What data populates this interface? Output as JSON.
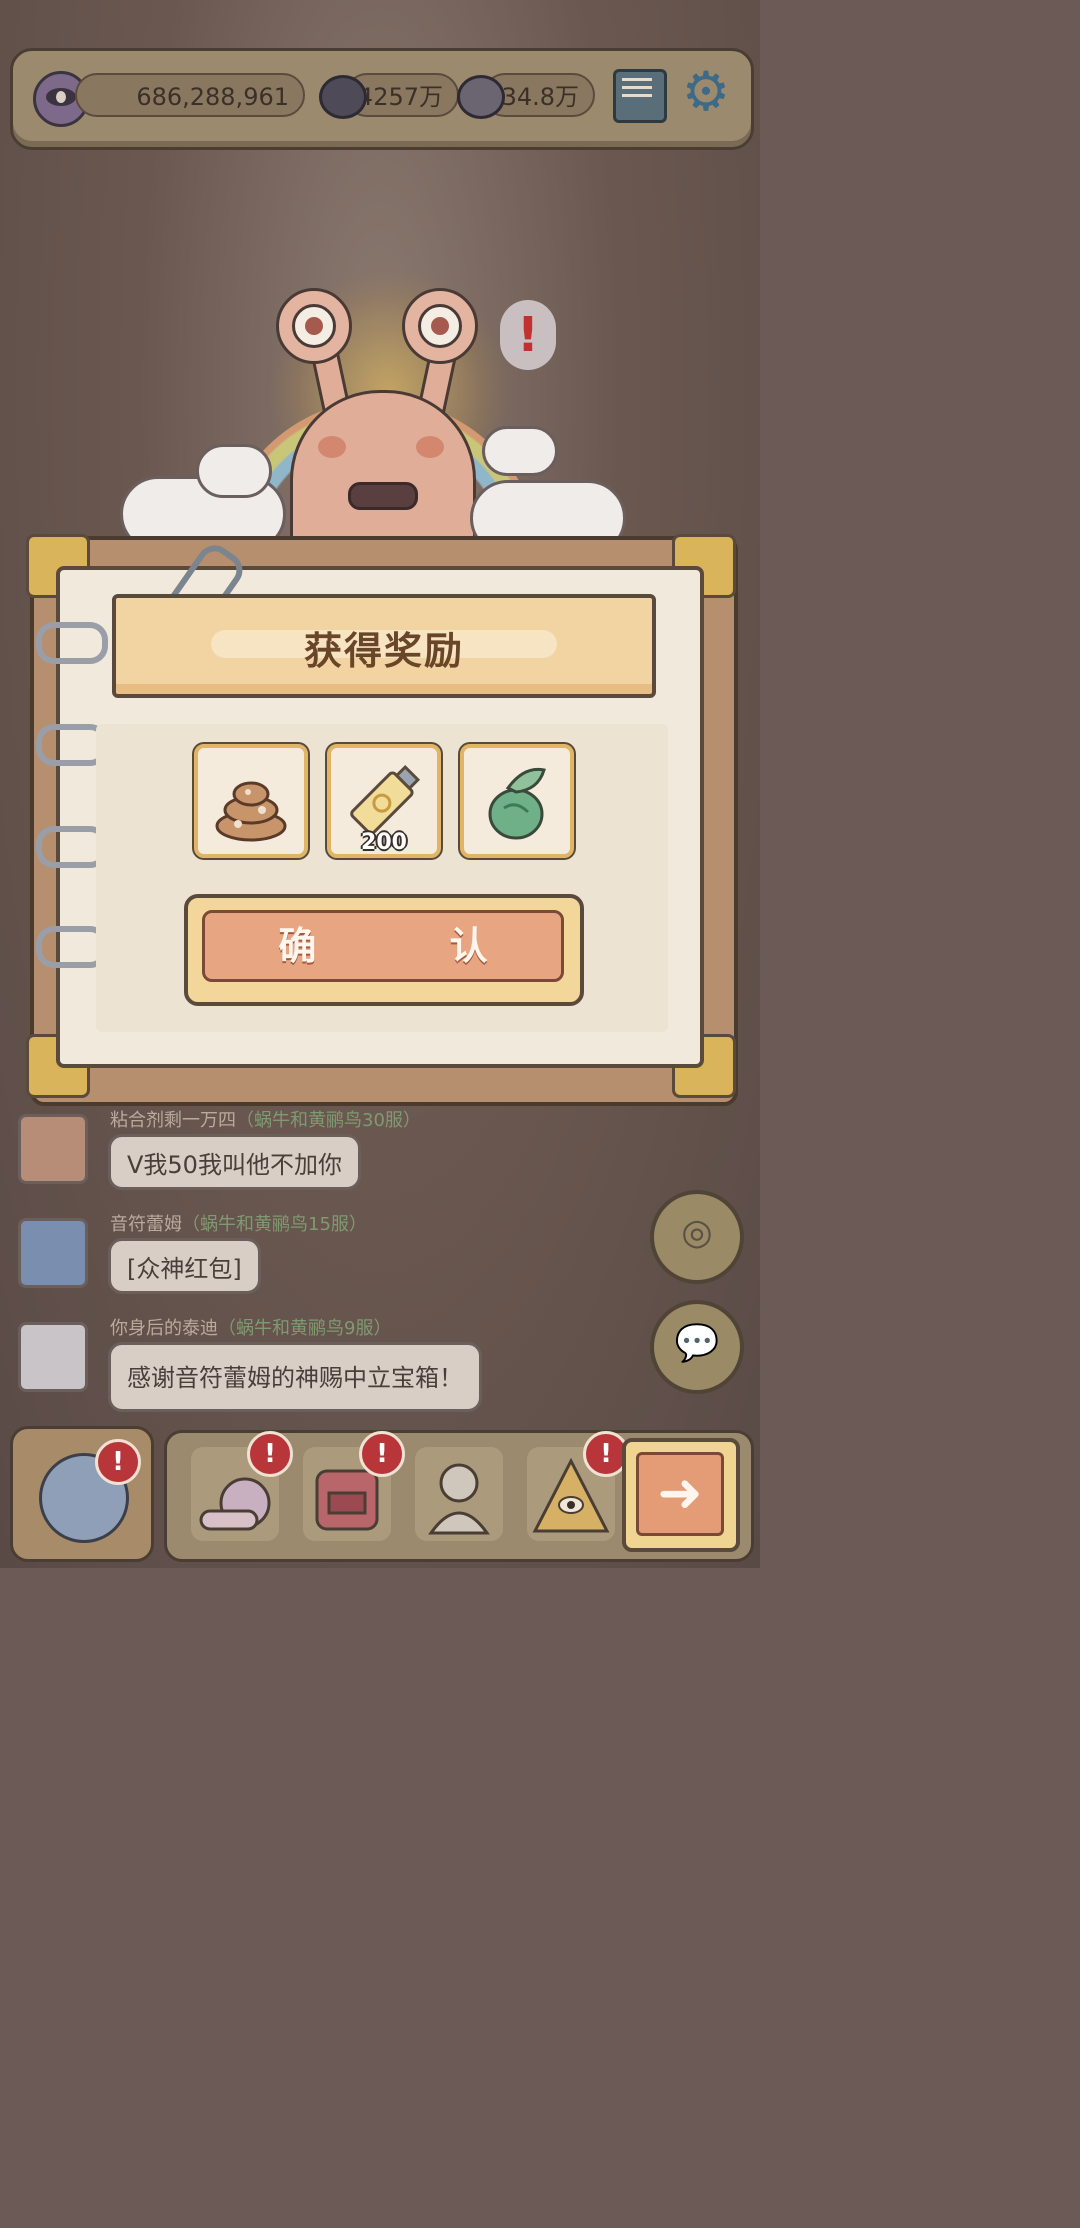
{
  "topbar": {
    "views": "686,288,961",
    "currency_a": "4257万",
    "currency_b": "34.8万",
    "mail_icon": "mail-icon",
    "settings_icon": "gear-icon"
  },
  "dialog": {
    "title": "获得奖励",
    "rewards": [
      {
        "icon": "poop-icon",
        "count": ""
      },
      {
        "icon": "paste-tube-icon",
        "count": "200"
      },
      {
        "icon": "green-gourd-icon",
        "count": ""
      }
    ],
    "confirm_label": "确 认"
  },
  "chat": [
    {
      "name": "粘合剂剩一万四",
      "server": "（蜗牛和黄鹂鸟30服）",
      "message": "V我50我叫他不加你"
    },
    {
      "name": "音符蕾姆",
      "server": "（蜗牛和黄鹂鸟15服）",
      "message": "[众神红包]"
    },
    {
      "name": "你身后的泰迪",
      "server": "（蜗牛和黄鹂鸟9服）",
      "message": "感谢音符蕾姆的神赐中立宝箱！"
    }
  ],
  "bottom_nav": {
    "badges": [
      "!",
      "!",
      "!",
      "!",
      "!"
    ],
    "next_icon": "arrow-right-icon"
  },
  "colors": {
    "dialog_banner": "#f2d4a3",
    "confirm_button": "#e8a582",
    "badge_red": "#b8353a"
  }
}
